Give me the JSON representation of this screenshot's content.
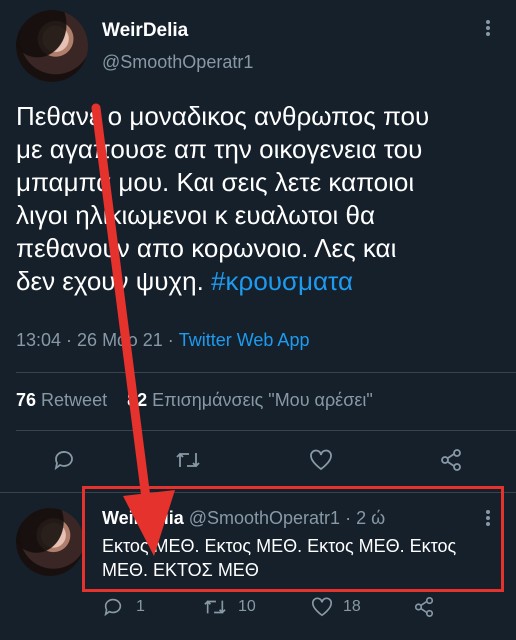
{
  "tweet": {
    "author_name": "WeirDelia",
    "author_handle": "@SmoothOperatr1",
    "text_lines": [
      "Πεθανε ο μοναδικος ανθρωπος που",
      "με αγαπουσε απ την οικογενεια του",
      "μπαμπα μου. Και σεις λετε καποιοι",
      "λιγοι ηλικιωμενοι κ ευαλωτοι θα",
      "πεθανουν απο κορωνοιο. Λες και",
      "δεν εχουν ψυχη."
    ],
    "hashtag": "#κρουσματα",
    "timestamp": "13:04 · 26 Μαρ 21 · ",
    "source": "Twitter Web App",
    "retweets_count": "76",
    "retweets_label": "Retweet",
    "likes_count": "82",
    "likes_label": "Επισημάνσεις \"Μου αρέσει\""
  },
  "reply": {
    "author_name": "WeirDelia",
    "author_handle": "@SmoothOperatr1",
    "time": "· 2 ώ",
    "text_line1": "Εκτος ΜΕΘ. Εκτος ΜΕΘ. Εκτος ΜΕΘ. Εκτος",
    "text_line2": "ΜΕΘ. ΕΚΤΟΣ ΜΕΘ",
    "reply_count": "1",
    "retweet_count": "10",
    "like_count": "18"
  },
  "colors": {
    "background": "#15202b",
    "accent": "#1d9bf0",
    "muted": "#8899a6",
    "annotation": "#e5322d"
  },
  "icons": [
    "reply-icon",
    "retweet-icon",
    "like-icon",
    "share-icon",
    "more-icon"
  ]
}
